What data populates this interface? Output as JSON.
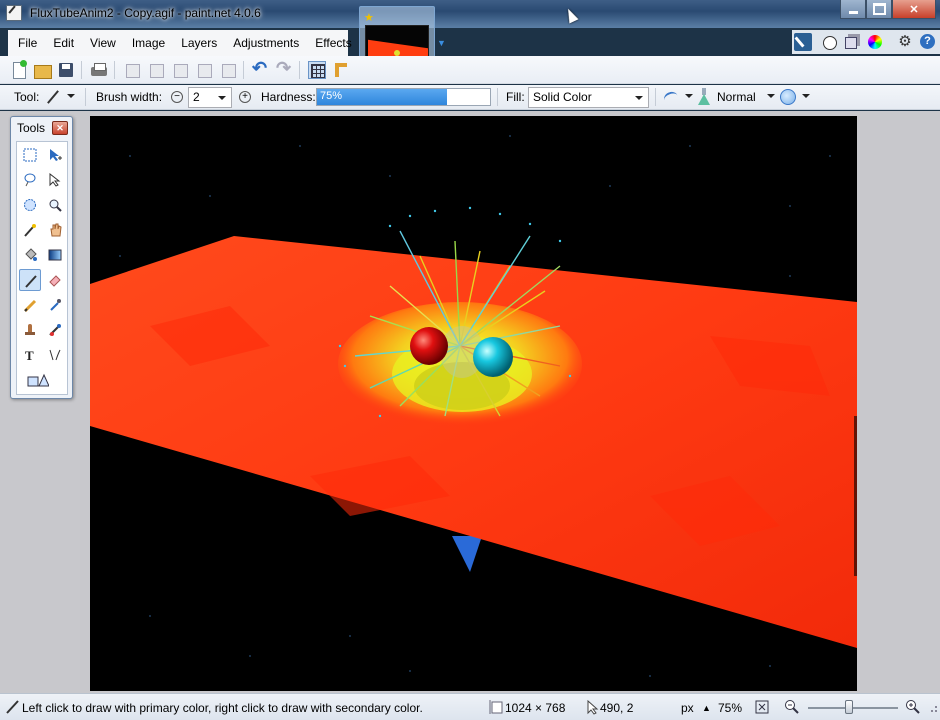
{
  "window": {
    "title": "FluxTubeAnim2 - Copy.agif - paint.net 4.0.6"
  },
  "menu": [
    "File",
    "Edit",
    "View",
    "Image",
    "Layers",
    "Adjustments",
    "Effects"
  ],
  "toolbar2": {
    "tool_label": "Tool:",
    "brush_width_label": "Brush width:",
    "brush_width_value": "2",
    "hardness_label": "Hardness:",
    "hardness_value": "75%",
    "hardness_percent": 75,
    "fill_label": "Fill:",
    "fill_value": "Solid Color",
    "blend_mode": "Normal"
  },
  "tools_window": {
    "title": "Tools",
    "tools": [
      "rectangle-select",
      "move-selected-pixels",
      "lasso-select",
      "move-selection",
      "ellipse-select",
      "zoom",
      "magic-wand",
      "pan",
      "paint-bucket",
      "gradient",
      "paintbrush",
      "eraser",
      "pencil",
      "color-picker",
      "clone-stamp",
      "recolor",
      "text",
      "line-curve",
      "shapes"
    ],
    "selected_tool": "paintbrush"
  },
  "status": {
    "hint": "Left click to draw with primary color, right click to draw with secondary color.",
    "image_size": "1024 × 768",
    "cursor_pos": "490, 2",
    "units": "px",
    "zoom": "75%"
  },
  "colors": {
    "plane": "#ff3a12",
    "background": "#000000",
    "accent": "#2f86dc"
  }
}
